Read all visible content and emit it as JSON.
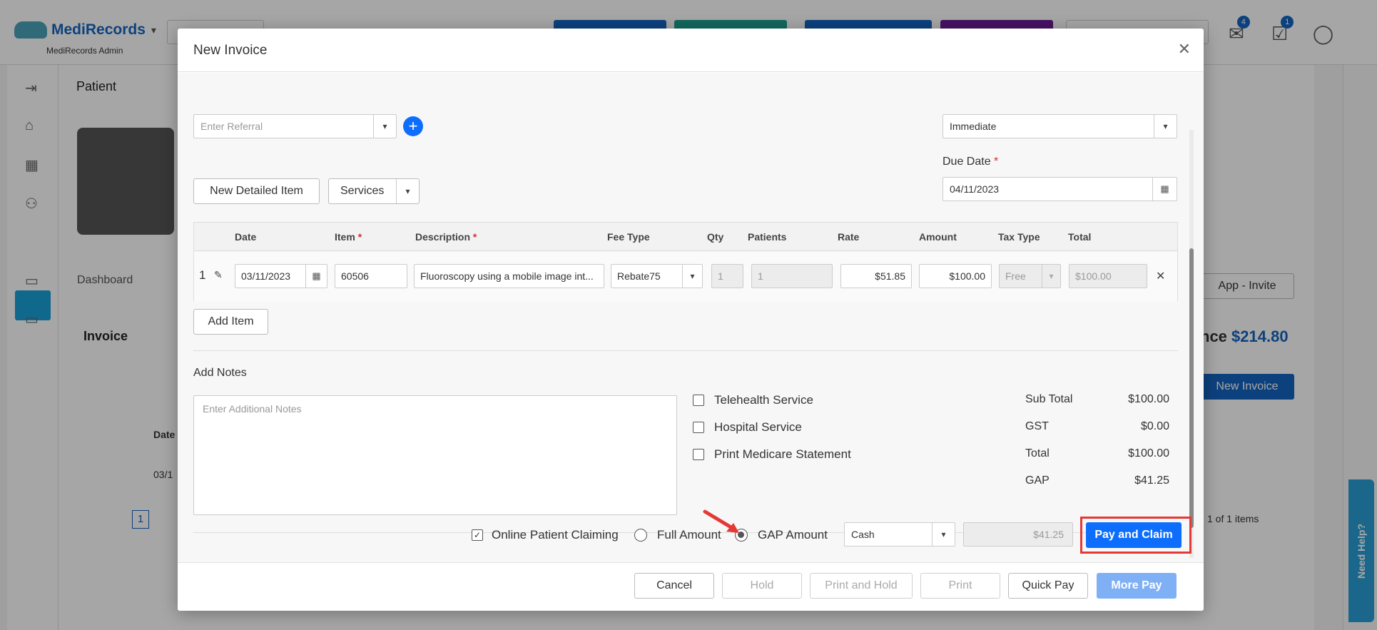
{
  "app": {
    "brand_part1": "Medi",
    "brand_part2": "Records",
    "subtitle": "MediRecords Admin",
    "mail_badge": "4",
    "tasks_badge": "1"
  },
  "background": {
    "patient_title": "Patient",
    "dashboard_tab": "Dashboard",
    "invoice_heading": "Invoice",
    "balance_label": "nce",
    "balance_value": "$214.80",
    "new_invoice_button": "New Invoice",
    "app_invite_button": "App - Invite",
    "date_col": "Date",
    "row_date": "03/1",
    "pager_page": "1",
    "pager_summary": "1 of 1 items",
    "need_help": "Need Help?"
  },
  "modal": {
    "title": "New Invoice",
    "referral_placeholder": "Enter Referral",
    "payment_term": "Immediate",
    "due_date_label": "Due Date",
    "due_date_value": "04/11/2023",
    "new_detailed_item_button": "New Detailed Item",
    "services_button": "Services",
    "add_item_button": "Add Item",
    "add_notes_label": "Add Notes",
    "notes_placeholder": "Enter Additional Notes"
  },
  "grid": {
    "headers": {
      "date": "Date",
      "item": "Item",
      "description": "Description",
      "fee_type": "Fee Type",
      "qty": "Qty",
      "patients": "Patients",
      "rate": "Rate",
      "amount": "Amount",
      "tax_type": "Tax Type",
      "total": "Total"
    },
    "rows": [
      {
        "index": "1",
        "date": "03/11/2023",
        "item": "60506",
        "description": "Fluoroscopy using a mobile image int...",
        "fee_type": "Rebate75",
        "qty": "1",
        "patients": "1",
        "rate": "$51.85",
        "amount": "$100.00",
        "tax_type": "Free",
        "total": "$100.00"
      }
    ]
  },
  "options": {
    "telehealth": "Telehealth Service",
    "hospital": "Hospital Service",
    "print_medicare": "Print Medicare Statement"
  },
  "summary": {
    "sub_total_label": "Sub Total",
    "sub_total": "$100.00",
    "gst_label": "GST",
    "gst": "$0.00",
    "total_label": "Total",
    "total": "$100.00",
    "gap_label": "GAP",
    "gap": "$41.25"
  },
  "payment": {
    "online_claiming": "Online Patient Claiming",
    "full_amount": "Full Amount",
    "gap_amount": "GAP Amount",
    "method": "Cash",
    "amount": "$41.25",
    "pay_and_claim": "Pay and Claim"
  },
  "footer": {
    "cancel": "Cancel",
    "hold": "Hold",
    "print_and_hold": "Print and Hold",
    "print": "Print",
    "quick_pay": "Quick Pay",
    "more_pay": "More Pay"
  },
  "colors": {
    "primary": "#0d6efd",
    "highlight": "#e53935",
    "brand_green": "#2e7d32"
  }
}
